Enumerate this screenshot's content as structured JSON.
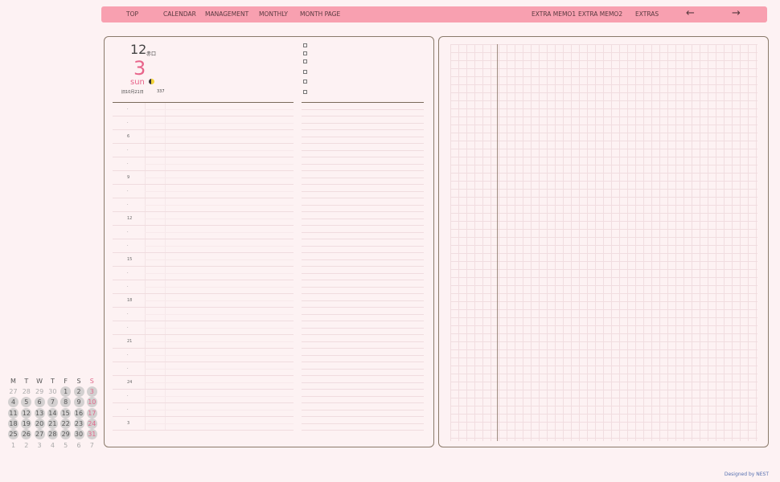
{
  "nav": {
    "items": [
      "TOP",
      "CALENDAR",
      "MANAGEMENT",
      "MONTHLY",
      "MONTH PAGE",
      "EXTRA MEMO1",
      "EXTRA MEMO2",
      "EXTRAS"
    ],
    "prev": "←",
    "next": "→"
  },
  "date": {
    "month": "12",
    "rokuyo": "赤口",
    "day": "3",
    "dow": "sun",
    "lunar": "旧10月21日",
    "day_of_year": "337"
  },
  "timeline": [
    "·",
    "·",
    "6",
    "·",
    "·",
    "9",
    "·",
    "·",
    "12",
    "·",
    "·",
    "15",
    "·",
    "·",
    "18",
    "·",
    "·",
    "21",
    "·",
    "·",
    "24",
    "·",
    "·",
    "3"
  ],
  "calendar": {
    "headers": [
      "M",
      "T",
      "W",
      "T",
      "F",
      "S",
      "S"
    ],
    "weeks": [
      [
        "27",
        "28",
        "29",
        "30",
        "1",
        "2",
        "3"
      ],
      [
        "4",
        "5",
        "6",
        "7",
        "8",
        "9",
        "10"
      ],
      [
        "11",
        "12",
        "13",
        "14",
        "15",
        "16",
        "17"
      ],
      [
        "18",
        "19",
        "20",
        "21",
        "22",
        "23",
        "24"
      ],
      [
        "25",
        "26",
        "27",
        "28",
        "29",
        "30",
        "31"
      ],
      [
        "1",
        "2",
        "3",
        "4",
        "5",
        "6",
        "7"
      ]
    ]
  },
  "credit": "Designed by NEST"
}
